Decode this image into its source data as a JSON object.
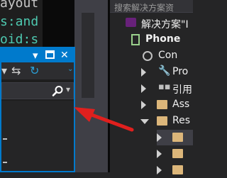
{
  "editor": {
    "lines": [
      "ayout",
      "s:and",
      "oid:s"
    ]
  },
  "solution_explorer": {
    "search_placeholder": "搜索解决方案资",
    "items": [
      {
        "label": "解决方案\"I"
      },
      {
        "label": "Phone"
      },
      {
        "label": "Con"
      },
      {
        "label": "Pro"
      },
      {
        "label": "引用"
      },
      {
        "label": "Ass"
      },
      {
        "label": "Res"
      },
      {
        "label": ""
      },
      {
        "label": ""
      },
      {
        "label": ""
      }
    ]
  },
  "tool_window": {
    "title_controls": {
      "dropdown": "▾",
      "maximize": "▫",
      "close": "✕"
    },
    "toolbar": {
      "sync": "⇆",
      "refresh": "↻",
      "dropdown": "▾"
    },
    "search": {
      "icon": "search-icon",
      "dropdown": "▾"
    }
  },
  "annotation": {
    "arrow_color": "#e0201e"
  },
  "colors": {
    "accent": "#007acc",
    "background": "#252526"
  }
}
